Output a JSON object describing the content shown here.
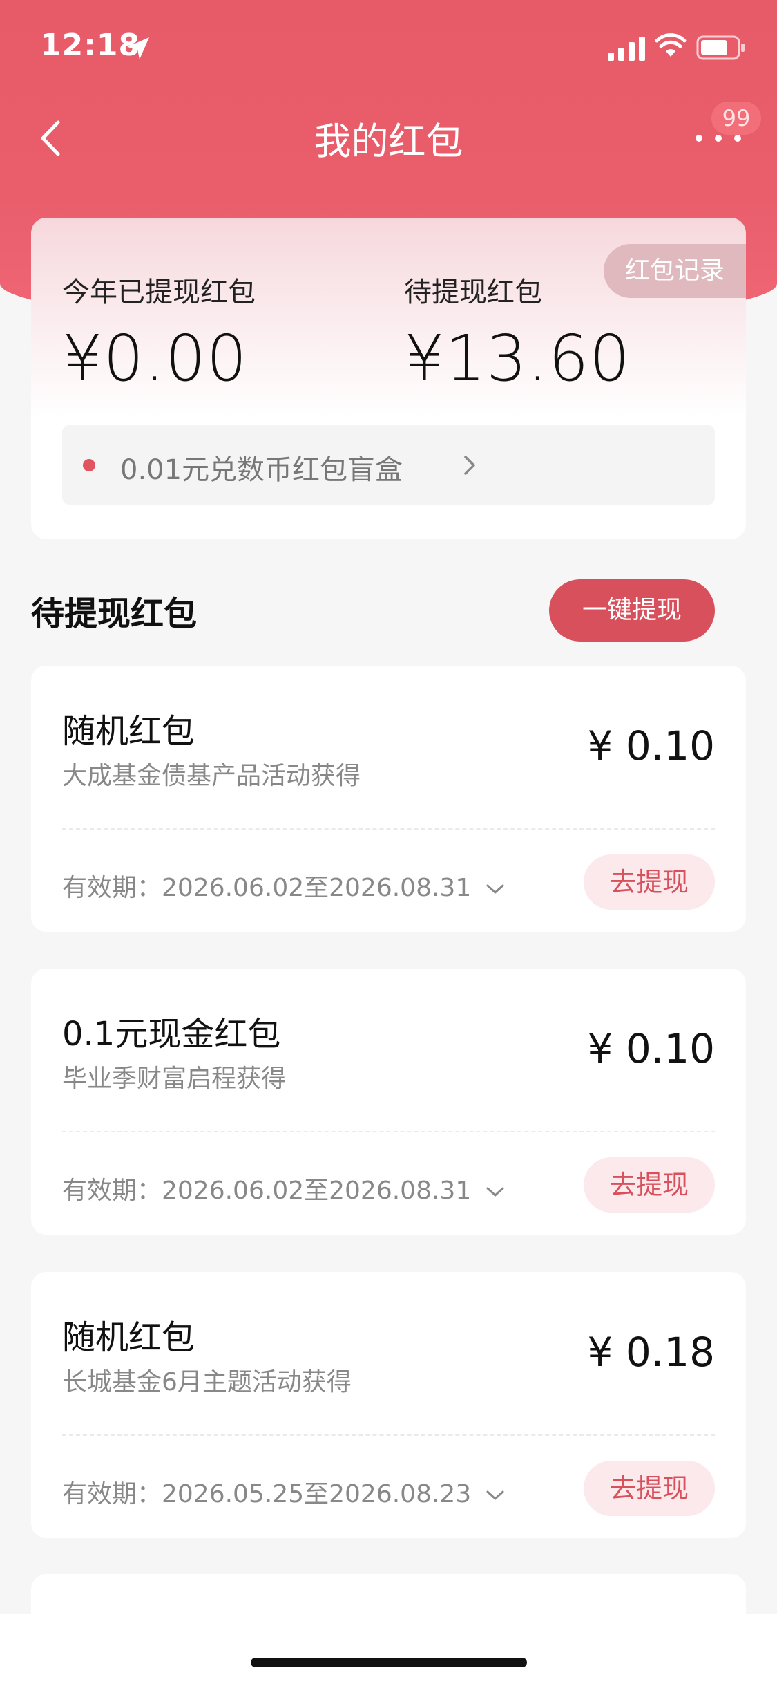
{
  "status_bar": {
    "time": "12:18"
  },
  "nav": {
    "title": "我的红包",
    "badge": "99"
  },
  "summary": {
    "record_label": "红包记录",
    "withdrawn_label": "今年已提现红包",
    "withdrawn_value": "¥0.00",
    "pending_label": "待提现红包",
    "pending_value": "¥13.60",
    "promo_text": "0.01元兑数币红包盲盒"
  },
  "section": {
    "title": "待提现红包",
    "withdraw_all": "一键提现"
  },
  "packets": [
    {
      "name": "随机红包",
      "source": "大成基金债基产品活动获得",
      "amount": "¥ 0.10",
      "validity": "有效期：2026.06.02至2026.08.31",
      "button": "去提现"
    },
    {
      "name": "0.1元现金红包",
      "source": "毕业季财富启程获得",
      "amount": "¥ 0.10",
      "validity": "有效期：2026.06.02至2026.08.31",
      "button": "去提现"
    },
    {
      "name": "随机红包",
      "source": "长城基金6月主题活动获得",
      "amount": "¥ 0.18",
      "validity": "有效期：2026.05.25至2026.08.23",
      "button": "去提现"
    }
  ],
  "colors": {
    "brand_red": "#e75a68",
    "button_red": "#d8505b",
    "button_light": "#fbe9eb"
  },
  "icons": [
    "location-arrow-icon",
    "signal-icon",
    "wifi-icon",
    "battery-icon",
    "back-chevron-icon",
    "more-dots-icon",
    "chevron-right-icon",
    "chevron-down-icon"
  ]
}
